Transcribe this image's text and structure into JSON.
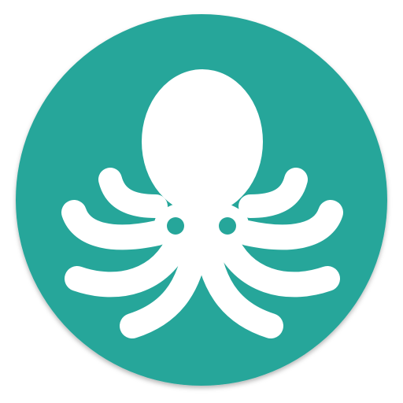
{
  "app_icon": {
    "icon_name": "octopus-icon",
    "background_color": "#26A69A",
    "foreground_color": "#FFFFFF"
  }
}
